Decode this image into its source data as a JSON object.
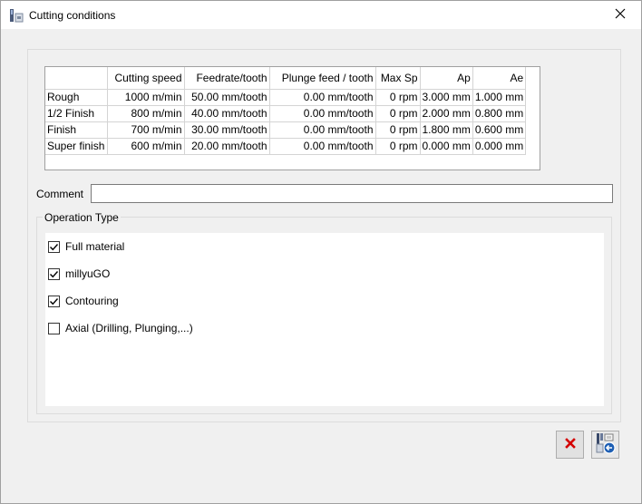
{
  "window": {
    "title": "Cutting conditions"
  },
  "table": {
    "columns": [
      "",
      "Cutting speed",
      "Feedrate/tooth",
      "Plunge feed / tooth",
      "Max Sp",
      "Ap",
      "Ae"
    ],
    "rows": [
      [
        "Rough",
        "1000 m/min",
        "50.00 mm/tooth",
        "0.00 mm/tooth",
        "0 rpm",
        "3.000 mm",
        "1.000 mm"
      ],
      [
        "1/2 Finish",
        "800 m/min",
        "40.00 mm/tooth",
        "0.00 mm/tooth",
        "0 rpm",
        "2.000 mm",
        "0.800 mm"
      ],
      [
        "Finish",
        "700 m/min",
        "30.00 mm/tooth",
        "0.00 mm/tooth",
        "0 rpm",
        "1.800 mm",
        "0.600 mm"
      ],
      [
        "Super finish",
        "600 m/min",
        "20.00 mm/tooth",
        "0.00 mm/tooth",
        "0 rpm",
        "0.000 mm",
        "0.000 mm"
      ]
    ]
  },
  "comment": {
    "label": "Comment",
    "value": ""
  },
  "operation_type": {
    "title": "Operation Type",
    "items": [
      {
        "label": "Full material",
        "checked": true
      },
      {
        "label": "millyuGO",
        "checked": true
      },
      {
        "label": "Contouring",
        "checked": true
      },
      {
        "label": "Axial (Drilling, Plunging,...)",
        "checked": false
      }
    ]
  },
  "icons": {
    "app": "app-tool-icon",
    "close": "close-icon",
    "cancel": "red-x-icon",
    "apply": "import-conditions-icon"
  },
  "colors": {
    "cancel_red": "#d40000",
    "apply_blue": "#1e5fb4"
  }
}
